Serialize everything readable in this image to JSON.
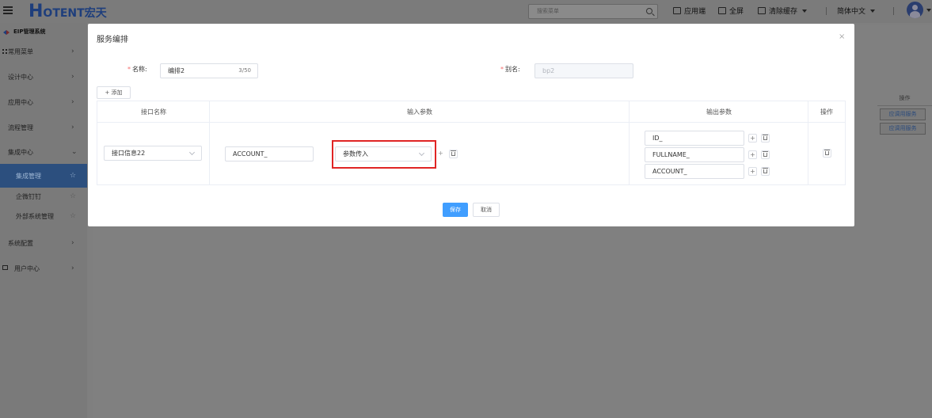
{
  "header": {
    "logo_h": "H",
    "logo_text": "OTENT宏天",
    "search_placeholder": "搜索菜单",
    "app_end": "应用端",
    "fullscreen": "全屏",
    "clear_cache": "清除缓存",
    "language": "简体中文",
    "icons": [
      "menu-toggle-icon",
      "search-icon",
      "monitor-icon",
      "fullscreen-icon",
      "clear-cache-icon",
      "avatar-icon"
    ]
  },
  "sidebar": {
    "system_title": "EIP管理系统",
    "items": [
      {
        "label": "常用菜单",
        "icon": "grid-icon"
      },
      {
        "label": "设计中心"
      },
      {
        "label": "应用中心"
      },
      {
        "label": "流程管理"
      },
      {
        "label": "集成中心",
        "expanded": true
      },
      {
        "label": "集成管理",
        "sub": true,
        "active": true
      },
      {
        "label": "企微钉钉",
        "sub": true
      },
      {
        "label": "外部系统管理",
        "sub": true
      },
      {
        "label": "系统配置"
      },
      {
        "label": "用户中心",
        "icon": "monitor-icon"
      }
    ],
    "chevron_right": "›",
    "chevron_down": "⌄",
    "star": "☆"
  },
  "background": {
    "col_header": "操作",
    "row_button": "应调用服务"
  },
  "modal": {
    "title": "服务编排",
    "close": "×",
    "name_label": "名称:",
    "name_value": "编排2",
    "name_count": "3/50",
    "alias_label": "别名:",
    "alias_value": "bp2",
    "required_mark": "*",
    "add_button": "+ 添加",
    "table": {
      "headers": [
        "接口名称",
        "输入参数",
        "输出参数",
        "操作"
      ],
      "row": {
        "interface_name": "接口信息22",
        "input_param_name": "ACCOUNT_",
        "input_param_source": "参数传入",
        "output_params": [
          "ID_",
          "FULLNAME_",
          "ACCOUNT_"
        ]
      }
    },
    "save_button": "保存",
    "cancel_button": "取消"
  },
  "colors": {
    "primary": "#409eff",
    "highlight_border": "#e02424",
    "required": "#f56c6c",
    "sidebar_active": "#2c4f7e"
  }
}
